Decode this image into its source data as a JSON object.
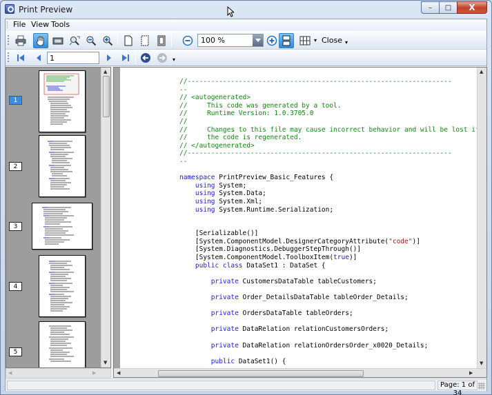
{
  "window": {
    "title": "Print Preview",
    "minimize": "–",
    "maximize": "□",
    "close": "X"
  },
  "menu": {
    "items": [
      "File",
      "View",
      "Tools"
    ]
  },
  "toolbar": {
    "zoom_value": "100 %",
    "close_label": "Close",
    "overflow": "▾"
  },
  "navigation": {
    "page_value": "1"
  },
  "thumbnails": {
    "pages": [
      "1",
      "2",
      "3",
      "4",
      "5"
    ],
    "selected": "1"
  },
  "document": {
    "lines": [
      {
        "t": "//-------------------------------------------------------------------",
        "c": "comment"
      },
      {
        "t": "--",
        "c": "comment"
      },
      {
        "t": "// <autogenerated>",
        "c": "comment"
      },
      {
        "t": "//     This code was generated by a tool.",
        "c": "comment"
      },
      {
        "t": "//     Runtime Version: 1.0.3705.0",
        "c": "comment"
      },
      {
        "t": "//",
        "c": "comment"
      },
      {
        "t": "//     Changes to this file may cause incorrect behavior and will be lost if",
        "c": "comment"
      },
      {
        "t": "//     the code is regenerated.",
        "c": "comment"
      },
      {
        "t": "// </autogenerated>",
        "c": "comment"
      },
      {
        "t": "//-------------------------------------------------------------------",
        "c": "comment"
      },
      {
        "t": "--",
        "c": "comment"
      },
      {
        "t": "",
        "c": ""
      },
      {
        "t": "namespace PrintPreview_Basic_Features {",
        "c": "ns"
      },
      {
        "t": "    using System;",
        "c": "using"
      },
      {
        "t": "    using System.Data;",
        "c": "using"
      },
      {
        "t": "    using System.Xml;",
        "c": "using"
      },
      {
        "t": "    using System.Runtime.Serialization;",
        "c": "using"
      },
      {
        "t": "",
        "c": ""
      },
      {
        "t": "",
        "c": ""
      },
      {
        "t": "    [Serializable()]",
        "c": "plain"
      },
      {
        "t": "    [System.ComponentModel.DesignerCategoryAttribute(\"code\")]",
        "c": "attrstr"
      },
      {
        "t": "    [System.Diagnostics.DebuggerStepThrough()]",
        "c": "plain"
      },
      {
        "t": "    [System.ComponentModel.ToolboxItem(true)]",
        "c": "attrkw"
      },
      {
        "t": "    public class DataSet1 : DataSet {",
        "c": "class"
      },
      {
        "t": "",
        "c": ""
      },
      {
        "t": "        private CustomersDataTable tableCustomers;",
        "c": "priv"
      },
      {
        "t": "",
        "c": ""
      },
      {
        "t": "        private Order_DetailsDataTable tableOrder_Details;",
        "c": "priv"
      },
      {
        "t": "",
        "c": ""
      },
      {
        "t": "        private OrdersDataTable tableOrders;",
        "c": "priv"
      },
      {
        "t": "",
        "c": ""
      },
      {
        "t": "        private DataRelation relationCustomersOrders;",
        "c": "priv"
      },
      {
        "t": "",
        "c": ""
      },
      {
        "t": "        private DataRelation relationOrdersOrder_x0020_Details;",
        "c": "priv"
      },
      {
        "t": "",
        "c": ""
      },
      {
        "t": "        public DataSet1() {",
        "c": "pub"
      }
    ]
  },
  "status": {
    "left_text": "",
    "page_text": "Page: 1 of 34"
  }
}
